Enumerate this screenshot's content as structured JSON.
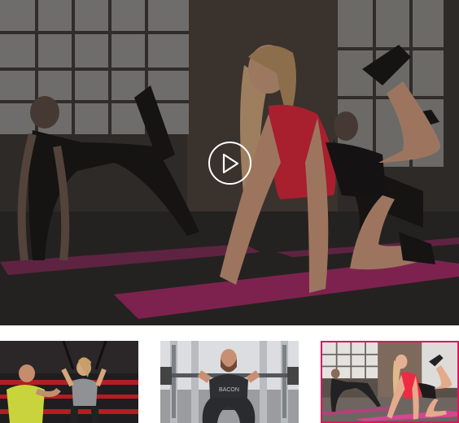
{
  "video_player": {
    "state": "paused",
    "play_icon": "play-icon"
  },
  "thumbnails": [
    {
      "id": "thumb-1",
      "selected": false
    },
    {
      "id": "thumb-2",
      "selected": false
    },
    {
      "id": "thumb-3",
      "selected": true
    }
  ],
  "colors": {
    "selected_border": "#e3145b",
    "mat_pink": "#c0306f",
    "tank_red": "#d8283b"
  }
}
